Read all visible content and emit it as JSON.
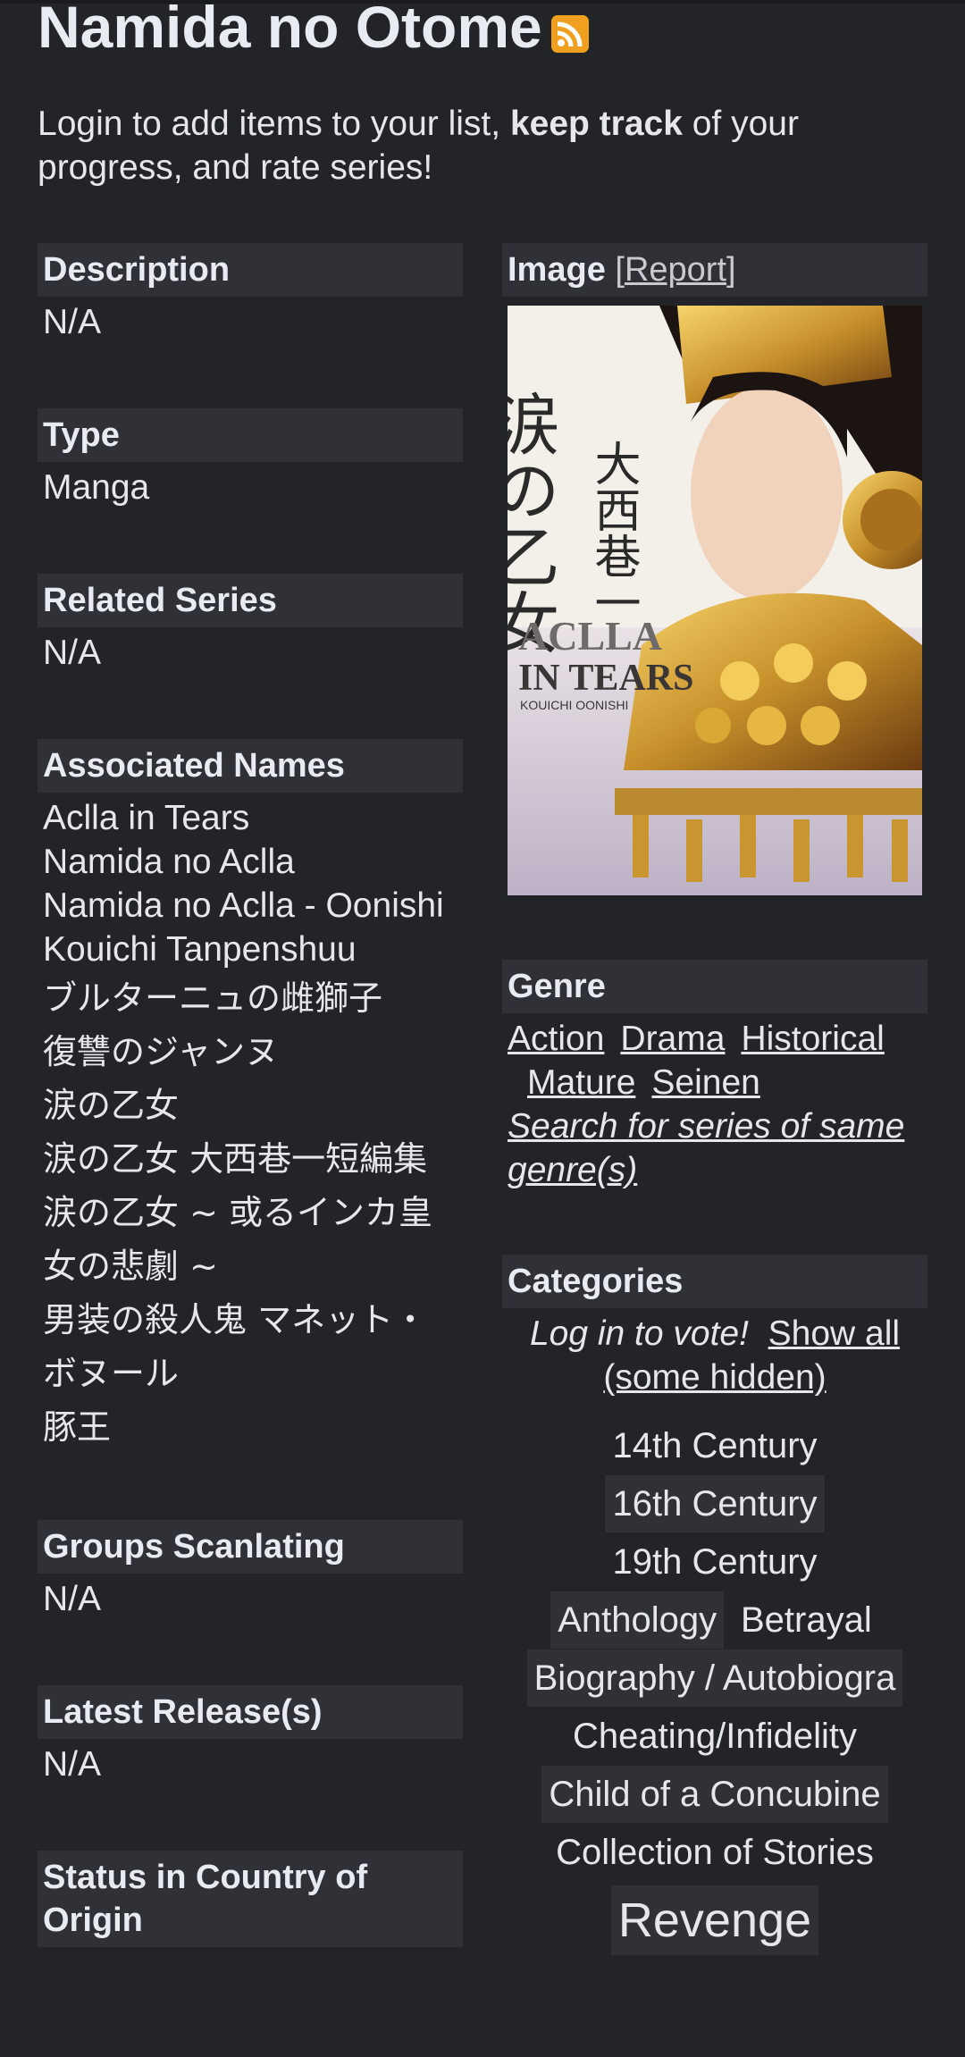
{
  "page": {
    "title": "Namida no Otome"
  },
  "login_prompt": {
    "before": "Login to add items to your list, ",
    "bold": "keep track",
    "after": " of your progress, and rate series!"
  },
  "sections": {
    "description": {
      "label": "Description",
      "value": "N/A"
    },
    "type": {
      "label": "Type",
      "value": "Manga"
    },
    "related": {
      "label": "Related Series",
      "value": "N/A"
    },
    "associated": {
      "label": "Associated Names",
      "names": [
        "Aclla in Tears",
        "Namida no Aclla",
        "Namida no Aclla - Oonishi Kouichi Tanpenshuu",
        "ブルターニュの雌獅子",
        "復讐のジャンヌ",
        "涙の乙女",
        "涙の乙女 大西巷一短編集",
        "涙の乙女 ~ 或るインカ皇女の悲劇 ~",
        "男装の殺人鬼 マネット・ボヌール",
        "豚王"
      ]
    },
    "groups": {
      "label": "Groups Scanlating",
      "value": "N/A"
    },
    "latest": {
      "label": "Latest Release(s)",
      "value": "N/A"
    },
    "status": {
      "label": "Status in Country of Origin"
    }
  },
  "image_section": {
    "label": "Image",
    "report_label": "Report",
    "cover_text": {
      "jp_title": "涙の乙女",
      "jp_author": "大西巷一",
      "en_line1": "ACLLA",
      "en_line2": "IN TEARS",
      "author_en": "KOUICHI OONISHI"
    }
  },
  "genre": {
    "label": "Genre",
    "items": [
      "Action",
      "Drama",
      "Historical",
      "Mature",
      "Seinen"
    ],
    "search_label": "Search for series of same genre(s)"
  },
  "categories": {
    "label": "Categories",
    "vote_text": "Log in to vote!",
    "show_all": "Show all (some hidden)",
    "items": [
      "14th Century",
      "16th Century",
      "19th Century",
      "Anthology",
      "Betrayal",
      "Biography / Autobiogra",
      "Cheating/Infidelity",
      "Child of a Concubine",
      "Collection of Stories",
      "Revenge"
    ]
  },
  "colors": {
    "background": "#232427",
    "section_header": "#2f3136",
    "rss": "#f0a01e"
  }
}
